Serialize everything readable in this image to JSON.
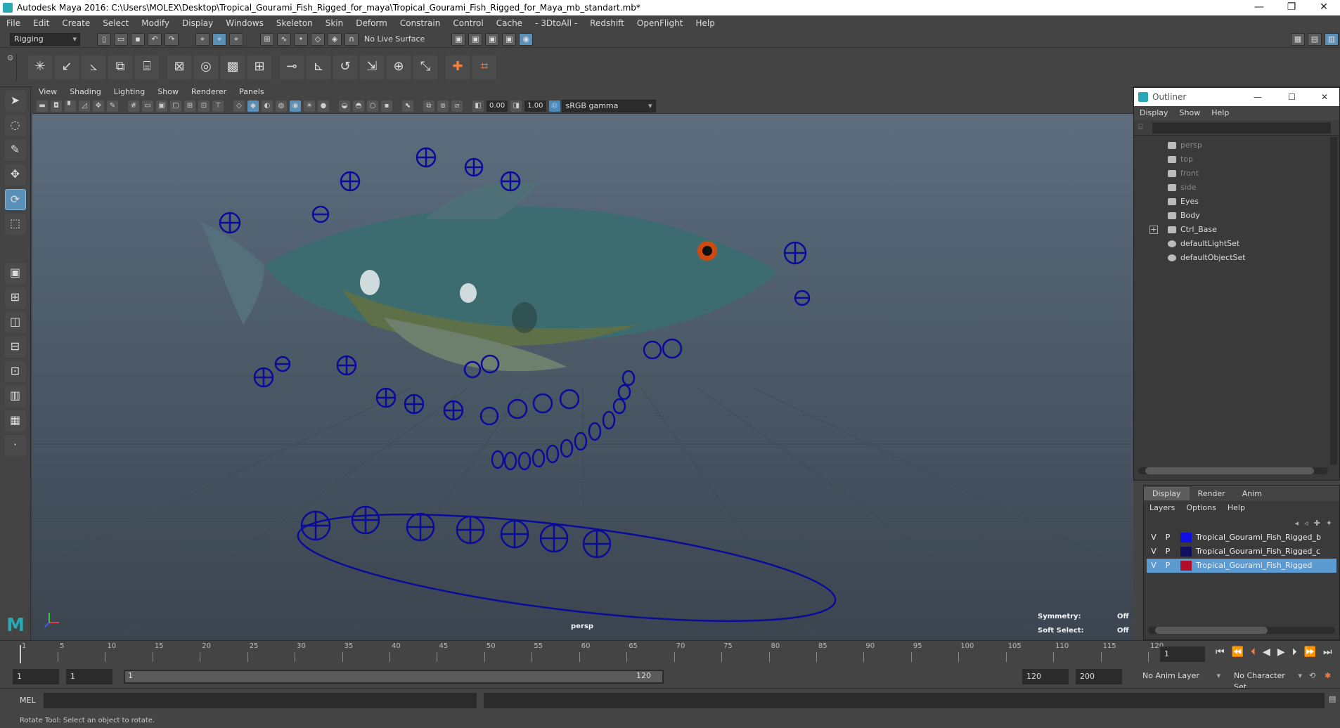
{
  "window": {
    "title": "Autodesk Maya 2016: C:\\Users\\MOLEX\\Desktop\\Tropical_Gourami_Fish_Rigged_for_maya\\Tropical_Gourami_Fish_Rigged_for_Maya_mb_standart.mb*",
    "minimize": "—",
    "restore": "❐",
    "close": "✕"
  },
  "menubar": [
    "File",
    "Edit",
    "Create",
    "Select",
    "Modify",
    "Display",
    "Windows",
    "Skeleton",
    "Skin",
    "Deform",
    "Constrain",
    "Control",
    "Cache",
    "- 3DtoAll -",
    "Redshift",
    "OpenFlight",
    "Help"
  ],
  "statusline": {
    "menuset": "Rigging",
    "live_surface": "No Live Surface"
  },
  "viewport": {
    "menus": [
      "View",
      "Shading",
      "Lighting",
      "Show",
      "Renderer",
      "Panels"
    ],
    "near_value": "0.00",
    "far_value": "1.00",
    "color_space": "sRGB gamma",
    "camera_label": "persp",
    "hud": {
      "symmetry_label": "Symmetry:",
      "symmetry_value": "Off",
      "softselect_label": "Soft Select:",
      "softselect_value": "Off"
    }
  },
  "outliner": {
    "title": "Outliner",
    "menus": [
      "Display",
      "Show",
      "Help"
    ],
    "items": [
      {
        "label": "persp",
        "dim": true
      },
      {
        "label": "top",
        "dim": true
      },
      {
        "label": "front",
        "dim": true
      },
      {
        "label": "side",
        "dim": true
      },
      {
        "label": "Eyes",
        "dim": false
      },
      {
        "label": "Body",
        "dim": false
      },
      {
        "label": "Ctrl_Base",
        "dim": false
      },
      {
        "label": "defaultLightSet",
        "dim": false
      },
      {
        "label": "defaultObjectSet",
        "dim": false
      }
    ],
    "expand_symbol": "+"
  },
  "layer_editor": {
    "tabs": [
      "Display",
      "Render",
      "Anim"
    ],
    "menus": [
      "Layers",
      "Options",
      "Help"
    ],
    "layers": [
      {
        "v": "V",
        "p": "P",
        "name": "Tropical_Gourami_Fish_Rigged_b",
        "color": "#1010e0",
        "selected": false
      },
      {
        "v": "V",
        "p": "P",
        "name": "Tropical_Gourami_Fish_Rigged_c",
        "color": "#101060",
        "selected": false
      },
      {
        "v": "V",
        "p": "P",
        "name": "Tropical_Gourami_Fish_Rigged",
        "color": "#b0102a",
        "selected": true
      }
    ]
  },
  "timeline": {
    "ticks": [
      "1",
      "5",
      "10",
      "15",
      "20",
      "25",
      "30",
      "35",
      "40",
      "45",
      "50",
      "55",
      "60",
      "65",
      "70",
      "75",
      "80",
      "85",
      "90",
      "95",
      "100",
      "105",
      "110",
      "115",
      "120"
    ],
    "current_frame": "1",
    "range_start": "1",
    "playback_start": "1",
    "slider_start": "1",
    "slider_end": "120",
    "playback_end": "120",
    "range_end": "200",
    "anim_layer": "No Anim Layer",
    "character_set": "No Character Set"
  },
  "command_line": {
    "label": "MEL"
  },
  "help_line": "Rotate Tool: Select an object to rotate."
}
